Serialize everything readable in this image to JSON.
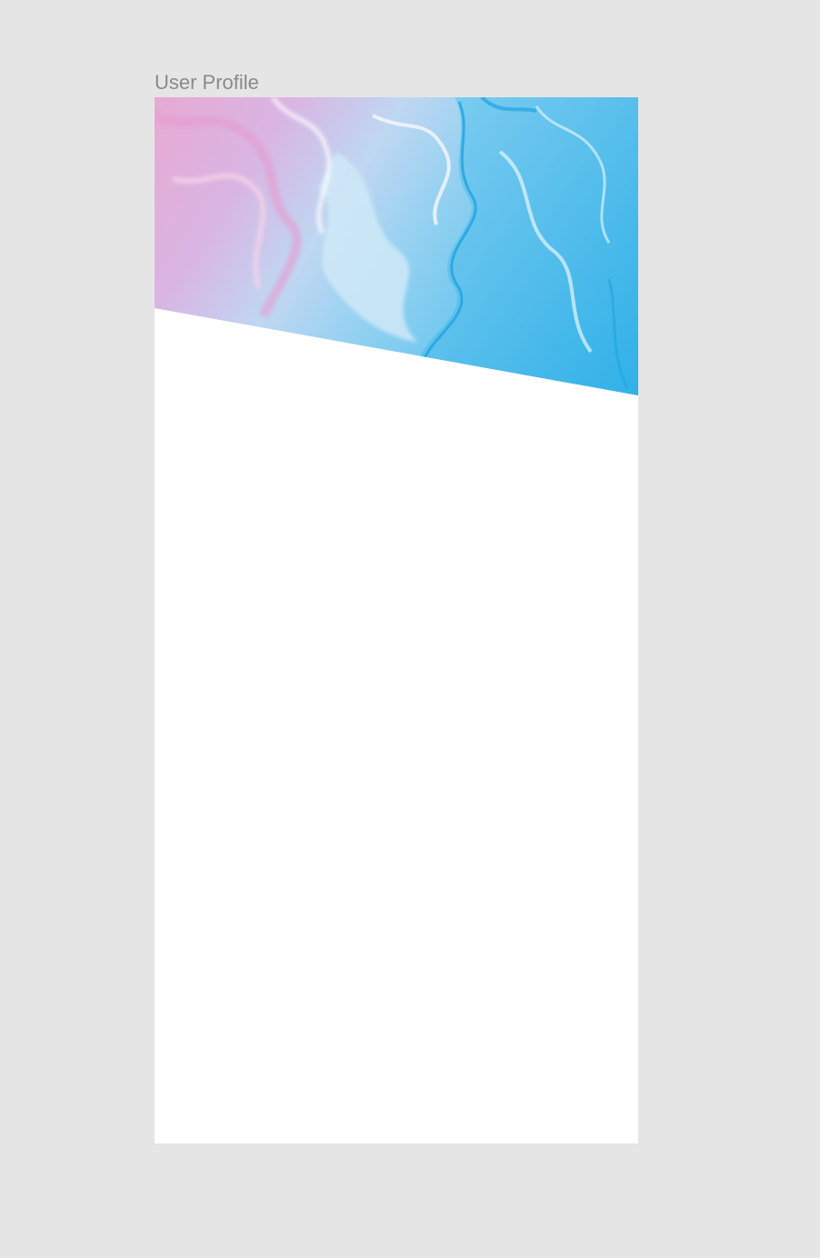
{
  "canvas": {
    "background_color": "#e5e5e5"
  },
  "frame": {
    "label": "User Profile",
    "background_color": "#ffffff"
  },
  "cover_image": {
    "description_icon": "marble-texture-image",
    "colors": {
      "pink": "#e8a9d2",
      "lavender": "#c9b8e6",
      "light_blue": "#a9dcf3",
      "blue": "#3bb6ea",
      "white_swirl": "#eef2fb"
    }
  }
}
